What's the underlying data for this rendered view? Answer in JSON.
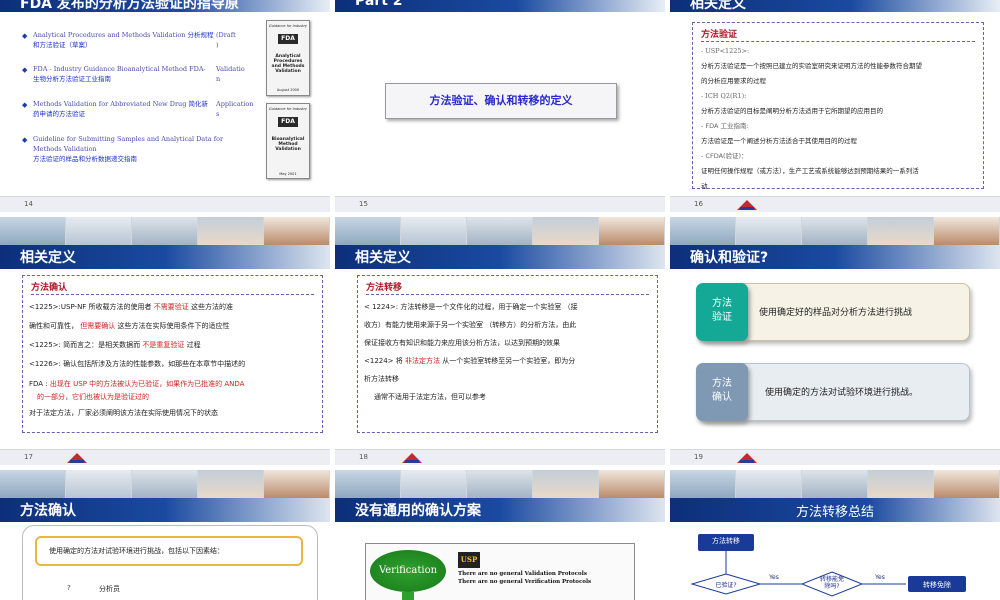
{
  "s14": {
    "title": "FDA 发布的分析方法验证的指导原",
    "items": [
      {
        "en": "Analytical Procedures and Methods Validation",
        "cn": "分析规程和方法验证（草案）",
        "right": "(Draft\n)"
      },
      {
        "en": "FDA - Industry Guidance Bioanalytical Method FDA-",
        "cn": "生物分析方法验证工业指南",
        "right": "Validatio\nn"
      },
      {
        "en": "Methods Validation for Abbreviated New Drug",
        "cn": "简化新药申请的方法验证",
        "right": "Application\ns"
      },
      {
        "en": "Guideline for Submitting Samples and Analytical Data for Methods Validation",
        "cn": "方法验证的样品和分析数据递交指南",
        "right": ""
      }
    ],
    "doc1": {
      "top": "Guidance for Industry",
      "logo": "FDA",
      "title": "Analytical Procedures and Methods Validation",
      "date": "August 2000"
    },
    "doc2": {
      "top": "Guidance for Industry",
      "logo": "FDA",
      "title": "Bioanalytical Method Validation",
      "date": "May 2001"
    },
    "page": "14"
  },
  "s15": {
    "title": "Part 2",
    "box": "方法验证、确认和转移的定义",
    "page": "15"
  },
  "s16": {
    "title": "相关定义",
    "subtitle": "方法验证",
    "lines": [
      "- USP<1225>:",
      "分析方法验证是一个按照已建立的实验室研究来证明方法的性能参数符合期望",
      "的分析应用要求的过程",
      "- ICH Q2(R1):",
      "分析方法验证的目标是阐明分析方法适用于它所期望的应用目的",
      "- FDA 工业指南:",
      "方法验证是一个阐述分析方法适合于其使用目的的过程",
      "- CFDA(验证)：",
      "证明任何操作规程（或方法），生产工艺或系统能够达到预期结果的一系列活",
      "动"
    ],
    "page": "16"
  },
  "s17": {
    "title": "相关定义",
    "subtitle": "方法确认",
    "l1a": "<1225>:USP-NF  所收载方法的使用者",
    "l1r": "不需要验证",
    "l1b": "这些方法的准",
    "l2a": "确性和可靠性，",
    "l2r": "但需要确认",
    "l2b": "这些方法在实际使用条件下的适应性",
    "l3a": "<1225>:  简而言之：是相关数据而",
    "l3r": "不是重复验证",
    "l3b": "过程",
    "l4": "<1226>:  确认包括所涉及方法的性能参数，如那些在本章节中描述的",
    "l5a": "FDA  :",
    "l5r": "出现在  USP   中的方法被认为已验证，如果作为已批准的  ANDA",
    "l6r": "的一部分，它们也被认为是验证过的",
    "l7": "对于法定方法，厂家必须阐明该方法在实际使用情况下的状态",
    "page": "17"
  },
  "s18": {
    "title": "相关定义",
    "subtitle": "方法转移",
    "l1": "< 1224>:  方法转移是一个文件化的过程，用于确定一个实验室  （接",
    "l2": "收方）有能力使用来源于另一个实验室  （转移方）的分析方法，由此",
    "l3": "保证接收方有知识和能力来应用该分析方法，以达到预期的效果",
    "l4a": "<1224>  将",
    "l4r": "非法定方法",
    "l4b": "从一个实验室转移至另一个实验室，即为分",
    "l5": "析方法转移",
    "l6": "通常不适用于法定方法，但可以参考",
    "page": "18"
  },
  "s19": {
    "title": "确认和验证?",
    "cards": [
      {
        "tab": "方法\n验证",
        "text": "使用确定好的样品对分析方法进行挑战",
        "color": "#14a896"
      },
      {
        "tab": "方法\n确认",
        "text": "使用确定的方法对试验环境进行挑战。",
        "color": "#7f98b4"
      }
    ],
    "page": "19"
  },
  "s20": {
    "title": "方法确认",
    "box": "使用确定的方法对试验环境进行挑战，包括以下因素结：",
    "q": "?",
    "item": "分析员"
  },
  "s21": {
    "title": "没有通用的确认方案",
    "ellipse": "Verification",
    "usp": "USP",
    "line1": "There are no general Validation Protocols",
    "line2": "There are no general Verification Protocols"
  },
  "s22": {
    "title": "方法转移总结",
    "start": "方法转移",
    "q1": "已验证?",
    "yes1": "Yes",
    "q2": "转移能免\n除吗?",
    "yes2": "Yes",
    "end": "转移免除"
  },
  "colors": {
    "navy": "#0d2f7a",
    "teal": "#14a896",
    "grayblue": "#7f98b4",
    "red": "#d02020"
  }
}
